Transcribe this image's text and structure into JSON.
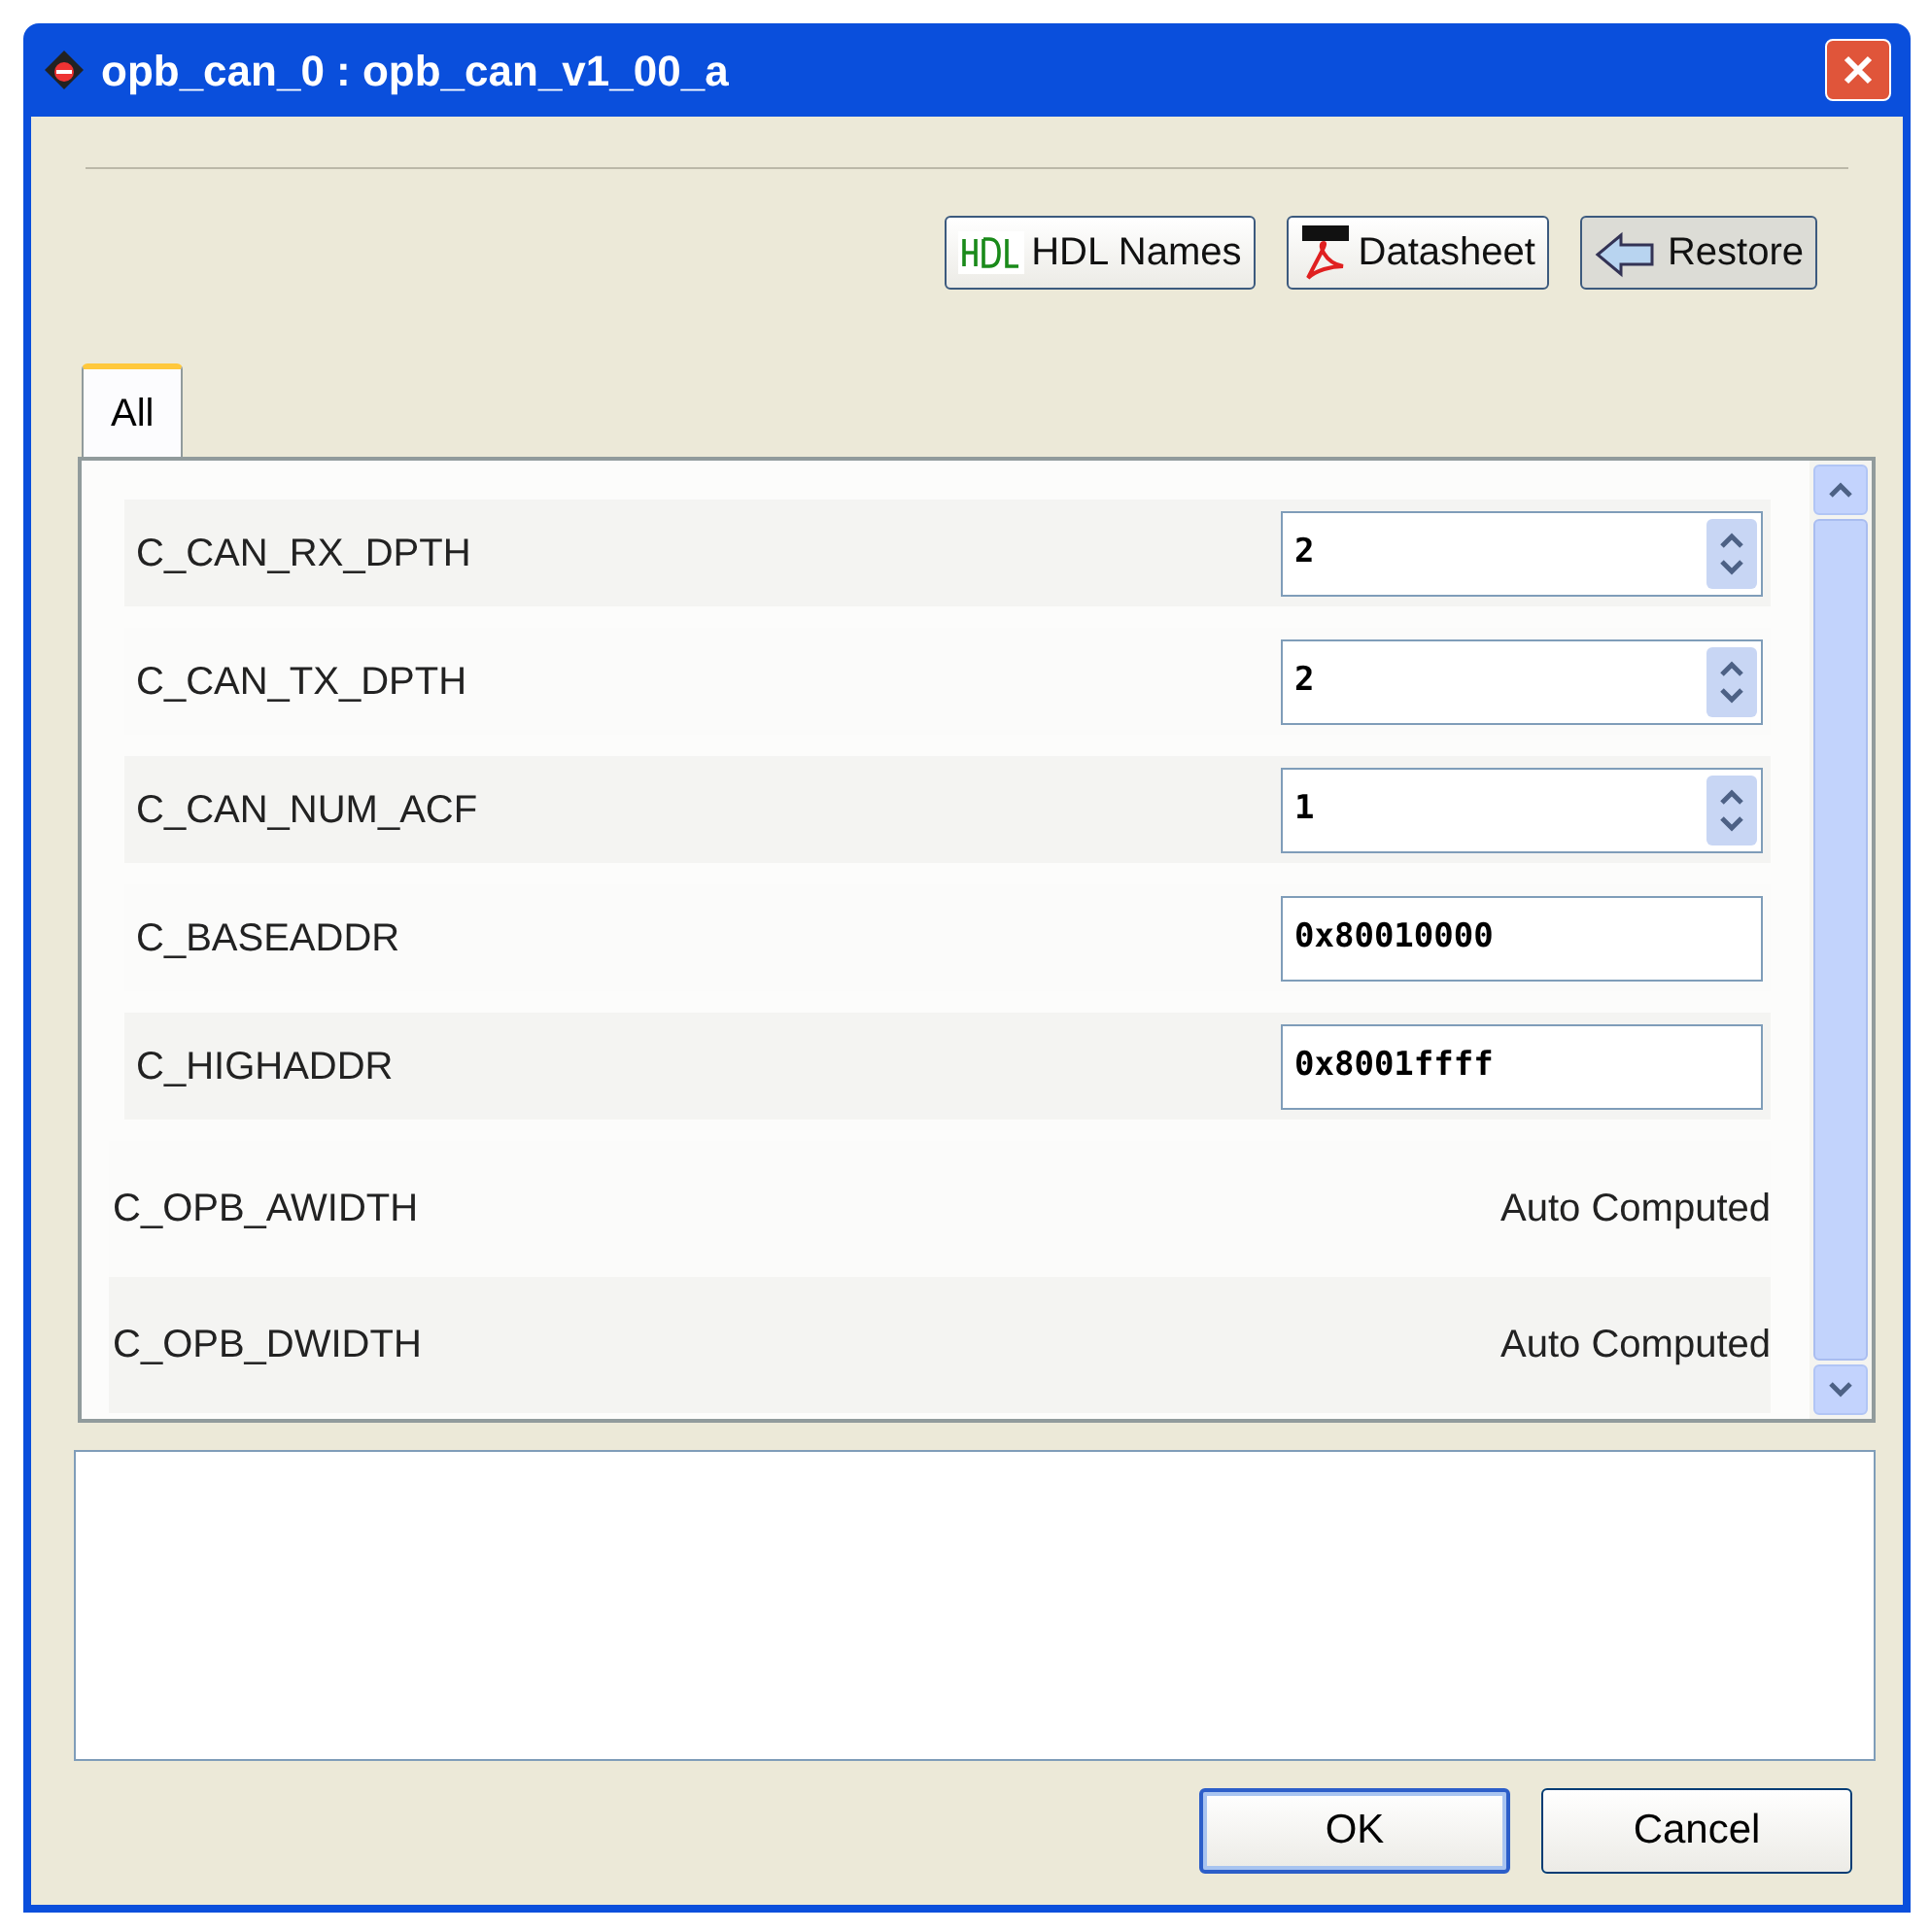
{
  "window": {
    "title": "opb_can_0 : opb_can_v1_00_a"
  },
  "toolbar": [
    {
      "kind": "hdl",
      "label": "HDL Names"
    },
    {
      "kind": "pdf",
      "label": "Datasheet"
    },
    {
      "kind": "restore",
      "label": "Restore"
    }
  ],
  "tabs": [
    {
      "label": "All",
      "selected": true
    }
  ],
  "parameters": [
    {
      "name": "C_CAN_RX_DPTH",
      "kind": "spinner",
      "value": "2"
    },
    {
      "name": "C_CAN_TX_DPTH",
      "kind": "spinner",
      "value": "2"
    },
    {
      "name": "C_CAN_NUM_ACF",
      "kind": "spinner",
      "value": "1"
    },
    {
      "name": "C_BASEADDR",
      "kind": "text",
      "value": "0x80010000"
    },
    {
      "name": "C_HIGHADDR",
      "kind": "text",
      "value": "0x8001ffff"
    },
    {
      "name": "C_OPB_AWIDTH",
      "kind": "auto",
      "value": "Auto Computed"
    },
    {
      "name": "C_OPB_DWIDTH",
      "kind": "auto",
      "value": "Auto Computed"
    }
  ],
  "buttons": [
    {
      "label": "OK",
      "default": true
    },
    {
      "label": "Cancel",
      "default": false
    }
  ]
}
